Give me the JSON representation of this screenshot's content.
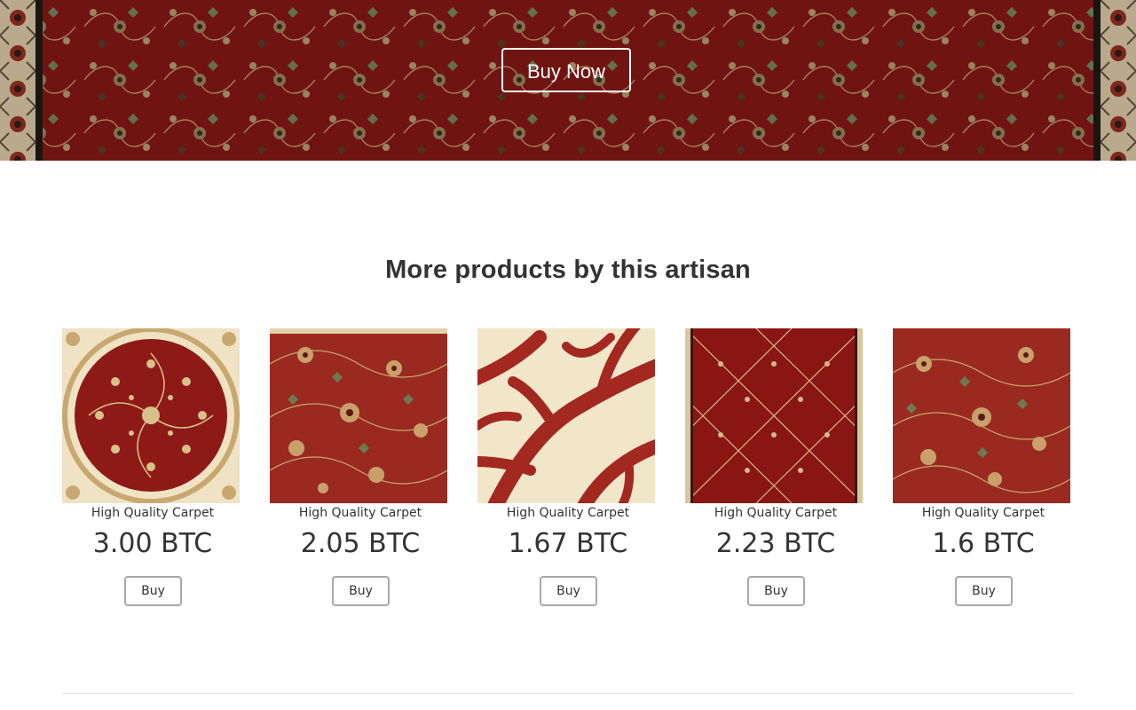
{
  "hero": {
    "cta_label": "Buy Now"
  },
  "section": {
    "title": "More products by this artisan"
  },
  "products": [
    {
      "name": "High Quality Carpet",
      "price": "3.00 BTC",
      "buy_label": "Buy",
      "pattern": "round-medallion"
    },
    {
      "name": "High Quality Carpet",
      "price": "2.05 BTC",
      "buy_label": "Buy",
      "pattern": "floral-red"
    },
    {
      "name": "High Quality Carpet",
      "price": "1.67 BTC",
      "buy_label": "Buy",
      "pattern": "coral-branches"
    },
    {
      "name": "High Quality Carpet",
      "price": "2.23 BTC",
      "buy_label": "Buy",
      "pattern": "diamond-lattice"
    },
    {
      "name": "High Quality Carpet",
      "price": "1.6 BTC",
      "buy_label": "Buy",
      "pattern": "floral-red"
    }
  ],
  "colors": {
    "carpet_red": "#8e1a17",
    "carpet_dark": "#5a0e0c",
    "carpet_cream": "#efe3c3",
    "carpet_gold": "#b89a5a",
    "text": "#333333",
    "button_border": "#a8a8a8"
  }
}
